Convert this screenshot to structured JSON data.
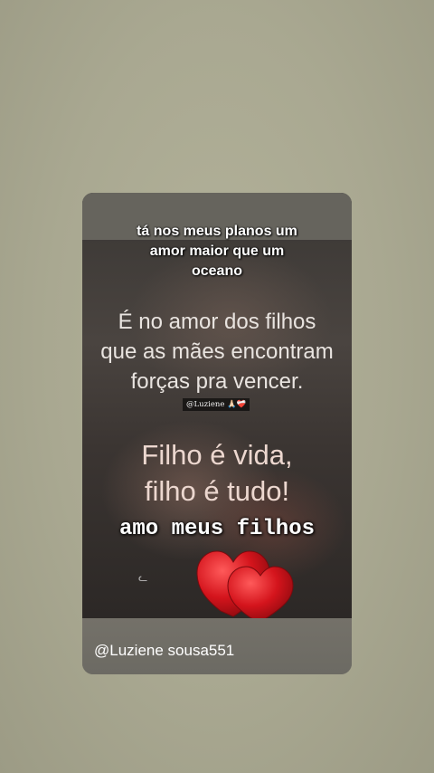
{
  "story": {
    "caption_lines": [
      "tá nos meus planos um",
      "amor maior que um",
      "oceano"
    ],
    "quote_lines": [
      "É no amor dos filhos",
      "que as mães encontram",
      "forças pra vencer."
    ],
    "watermark": "@Luziene 🙏🏻❤️‍🩹",
    "quote2_lines": [
      "Filho é vida,",
      "filho é tudo!"
    ],
    "big_caption": "amo meus filhos",
    "username": "@Luziene sousa551",
    "heart_color": "#d4141c",
    "icons": [
      "heart-icon",
      "heart-icon"
    ]
  }
}
